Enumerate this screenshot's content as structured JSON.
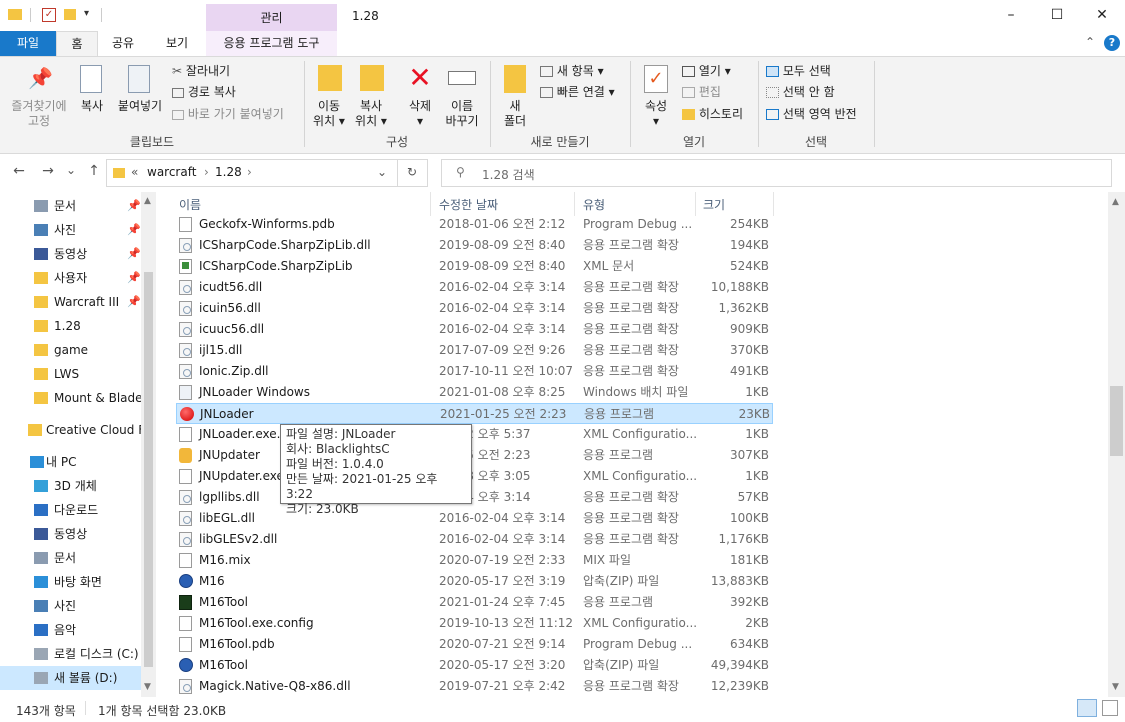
{
  "window": {
    "title": "1.28",
    "context_tab": "관리",
    "controls": {
      "minimize": "–",
      "maximize": "☐",
      "close": "✕"
    }
  },
  "tabs": {
    "file": "파일",
    "home": "홈",
    "share": "공유",
    "view": "보기",
    "app_tools": "응용 프로그램 도구"
  },
  "ribbon": {
    "clipboard": {
      "pin_quick_access_1": "즐겨찾기에",
      "pin_quick_access_2": "고정",
      "copy": "복사",
      "paste": "붙여넣기",
      "cut": "잘라내기",
      "copy_path": "경로 복사",
      "paste_shortcut": "바로 가기 붙여넣기",
      "group": "클립보드"
    },
    "organize": {
      "move_to_1": "이동",
      "move_to_2": "위치 ▾",
      "copy_to_1": "복사",
      "copy_to_2": "위치 ▾",
      "delete_1": "삭제",
      "delete_2": "▾",
      "rename_1": "이름",
      "rename_2": "바꾸기",
      "group": "구성"
    },
    "new": {
      "new_folder_1": "새",
      "new_folder_2": "폴더",
      "new_item": "새 항목 ▾",
      "easy_access": "빠른 연결 ▾",
      "group": "새로 만들기"
    },
    "open": {
      "properties_1": "속성",
      "properties_2": "▾",
      "open": "열기 ▾",
      "edit": "편집",
      "history": "히스토리",
      "group": "열기"
    },
    "select": {
      "select_all": "모두 선택",
      "select_none": "선택 안 함",
      "invert": "선택 영역 반전",
      "group": "선택"
    }
  },
  "address": {
    "back": "←",
    "forward": "→",
    "recent": "⌄",
    "up": "↑",
    "overflow": "«",
    "crumbs": [
      "warcraft",
      "1.28"
    ],
    "search_placeholder": "1.28 검색"
  },
  "nav": {
    "quick": [
      {
        "label": "문서",
        "icon": "documents-icon",
        "pinned": true
      },
      {
        "label": "사진",
        "icon": "pictures-icon",
        "pinned": true
      },
      {
        "label": "동영상",
        "icon": "videos-icon",
        "pinned": true
      },
      {
        "label": "사용자",
        "icon": "folder-icon",
        "pinned": true
      },
      {
        "label": "Warcraft III",
        "icon": "folder-icon",
        "pinned": true
      },
      {
        "label": "1.28",
        "icon": "folder-icon",
        "pinned": false
      },
      {
        "label": "game",
        "icon": "folder-icon",
        "pinned": false
      },
      {
        "label": "LWS",
        "icon": "folder-icon",
        "pinned": false
      },
      {
        "label": "Mount & Blade",
        "icon": "folder-icon",
        "pinned": false
      }
    ],
    "creative_cloud": "Creative Cloud Fil",
    "this_pc": "내 PC",
    "pc_items": [
      {
        "label": "3D 개체",
        "icon": "3d-objects-icon"
      },
      {
        "label": "다운로드",
        "icon": "downloads-icon"
      },
      {
        "label": "동영상",
        "icon": "videos-icon"
      },
      {
        "label": "문서",
        "icon": "documents-icon"
      },
      {
        "label": "바탕 화면",
        "icon": "desktop-icon"
      },
      {
        "label": "사진",
        "icon": "pictures-icon"
      },
      {
        "label": "음악",
        "icon": "music-icon"
      },
      {
        "label": "로컬 디스크 (C:)",
        "icon": "drive-icon"
      },
      {
        "label": "새 볼륨 (D:)",
        "icon": "drive-icon"
      }
    ]
  },
  "columns": {
    "name": "이름",
    "date": "수정한 날짜",
    "type": "유형",
    "size": "크기"
  },
  "files": [
    {
      "name": "Geckofx-Winforms.pdb",
      "date": "2018-01-06 오전 2:12",
      "type": "Program Debug ...",
      "size": "254KB",
      "icon": "doc"
    },
    {
      "name": "ICSharpCode.SharpZipLib.dll",
      "date": "2019-08-09 오전 8:40",
      "type": "응용 프로그램 확장",
      "size": "194KB",
      "icon": "dll"
    },
    {
      "name": "ICSharpCode.SharpZipLib",
      "date": "2019-08-09 오전 8:40",
      "type": "XML 문서",
      "size": "524KB",
      "icon": "xml"
    },
    {
      "name": "icudt56.dll",
      "date": "2016-02-04 오후 3:14",
      "type": "응용 프로그램 확장",
      "size": "10,188KB",
      "icon": "dll"
    },
    {
      "name": "icuin56.dll",
      "date": "2016-02-04 오후 3:14",
      "type": "응용 프로그램 확장",
      "size": "1,362KB",
      "icon": "dll"
    },
    {
      "name": "icuuc56.dll",
      "date": "2016-02-04 오후 3:14",
      "type": "응용 프로그램 확장",
      "size": "909KB",
      "icon": "dll"
    },
    {
      "name": "ijl15.dll",
      "date": "2017-07-09 오전 9:26",
      "type": "응용 프로그램 확장",
      "size": "370KB",
      "icon": "dll"
    },
    {
      "name": "Ionic.Zip.dll",
      "date": "2017-10-11 오전 10:07",
      "type": "응용 프로그램 확장",
      "size": "491KB",
      "icon": "dll"
    },
    {
      "name": "JNLoader Windows",
      "date": "2021-01-08 오후 8:25",
      "type": "Windows 배치 파일",
      "size": "1KB",
      "icon": "bat"
    },
    {
      "name": "JNLoader",
      "date": "2021-01-25 오전 2:23",
      "type": "응용 프로그램",
      "size": "23KB",
      "icon": "exe-red",
      "selected": true
    },
    {
      "name": "JNLoader.exe.c",
      "date": "01-02 오후 5:37",
      "type": "XML Configuratio...",
      "size": "1KB",
      "icon": "doc"
    },
    {
      "name": "JNUpdater",
      "date": "01-25 오전 2:23",
      "type": "응용 프로그램",
      "size": "307KB",
      "icon": "jnup"
    },
    {
      "name": "JNUpdater.exe.",
      "date": "01-08 오후 3:05",
      "type": "XML Configuratio...",
      "size": "1KB",
      "icon": "doc"
    },
    {
      "name": "lgpllibs.dll",
      "date": "02-04 오후 3:14",
      "type": "응용 프로그램 확장",
      "size": "57KB",
      "icon": "dll"
    },
    {
      "name": "libEGL.dll",
      "date": "2016-02-04 오후 3:14",
      "type": "응용 프로그램 확장",
      "size": "100KB",
      "icon": "dll"
    },
    {
      "name": "libGLESv2.dll",
      "date": "2016-02-04 오후 3:14",
      "type": "응용 프로그램 확장",
      "size": "1,176KB",
      "icon": "dll"
    },
    {
      "name": "M16.mix",
      "date": "2020-07-19 오전 2:33",
      "type": "MIX 파일",
      "size": "181KB",
      "icon": "doc"
    },
    {
      "name": "M16",
      "date": "2020-05-17 오전 3:19",
      "type": "압축(ZIP) 파일",
      "size": "13,883KB",
      "icon": "zip"
    },
    {
      "name": "M16Tool",
      "date": "2021-01-24 오후 7:45",
      "type": "응용 프로그램",
      "size": "392KB",
      "icon": "m16tool"
    },
    {
      "name": "M16Tool.exe.config",
      "date": "2019-10-13 오전 11:12",
      "type": "XML Configuratio...",
      "size": "2KB",
      "icon": "doc"
    },
    {
      "name": "M16Tool.pdb",
      "date": "2020-07-21 오전 9:14",
      "type": "Program Debug ...",
      "size": "634KB",
      "icon": "doc"
    },
    {
      "name": "M16Tool",
      "date": "2020-05-17 오전 3:20",
      "type": "압축(ZIP) 파일",
      "size": "49,394KB",
      "icon": "zip"
    },
    {
      "name": "Magick.Native-Q8-x86.dll",
      "date": "2019-07-21 오후 2:42",
      "type": "응용 프로그램 확장",
      "size": "12,239KB",
      "icon": "dll"
    }
  ],
  "tooltip": [
    "파일 설명: JNLoader",
    "회사: BlacklightsC",
    "파일 버전: 1.0.4.0",
    "만든 날짜: 2021-01-25 오후 3:22",
    "크기: 23.0KB"
  ],
  "status": {
    "item_count": "143개 항목",
    "selection": "1개 항목 선택함 23.0KB"
  },
  "colors": {
    "accent": "#1979ca",
    "selection": "#cce8ff",
    "context_tab": "#e9d6f2"
  }
}
